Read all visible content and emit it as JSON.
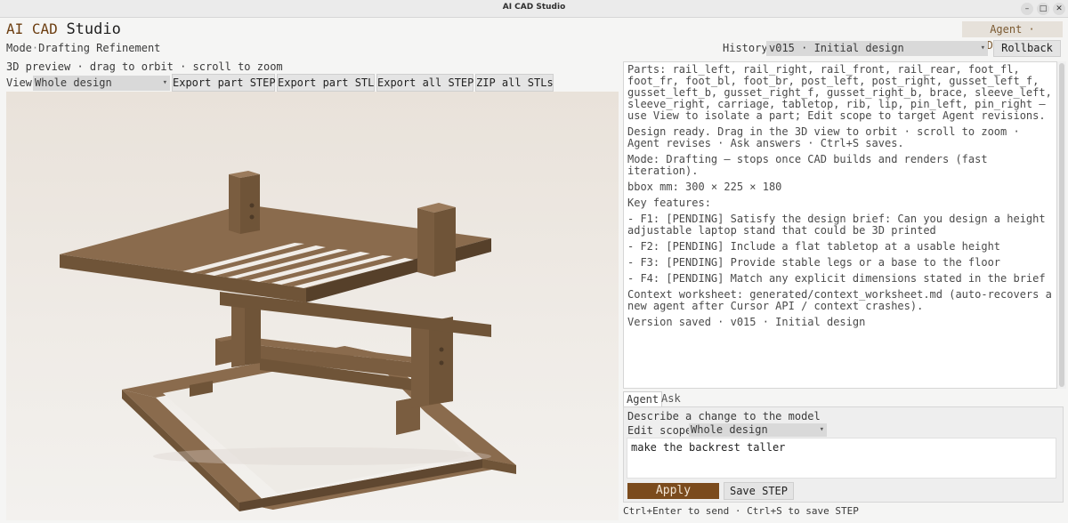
{
  "window": {
    "title": "AI CAD Studio",
    "controls": [
      "–",
      "□",
      "✕"
    ]
  },
  "brand": {
    "part_a": "AI CAD",
    "part_b": "Studio"
  },
  "mode_badge": "Agent · Drafting",
  "mode_row": {
    "label": "Mode",
    "value": "Drafting Refinement"
  },
  "history": {
    "label": "History",
    "selected": "v015 · Initial design",
    "rollback_label": "Rollback"
  },
  "preview_hint": "3D preview · drag to orbit · scroll to zoom",
  "toolbar": {
    "view_label": "View",
    "view_selected": "Whole design",
    "export_part_step": "Export part STEP",
    "export_part_stl": "Export part STL",
    "export_all_step": "Export all STEP",
    "zip_all_stls": "ZIP all STLs"
  },
  "info_lines": [
    "Parts: rail_left, rail_right, rail_front, rail_rear, foot_fl, foot_fr, foot_bl, foot_br, post_left, post_right, gusset_left_f, gusset_left_b, gusset_right_f, gusset_right_b, brace, sleeve_left, sleeve_right, carriage, tabletop, rib, lip, pin_left, pin_right — use View to isolate a part; Edit scope to target Agent revisions.",
    "Design ready. Drag in the 3D view to orbit · scroll to zoom · Agent revises · Ask answers · Ctrl+S saves.",
    "Mode: Drafting — stops once CAD builds and renders (fast iteration).",
    "bbox mm: 300 × 225 × 180",
    "Key features:",
    "- F1: [PENDING] Satisfy the design brief: Can you design a height adjustable laptop stand that could be 3D printed",
    "- F2: [PENDING] Include a flat tabletop at a usable height",
    "- F3: [PENDING] Provide stable legs or a base to the floor",
    "- F4: [PENDING] Match any explicit dimensions stated in the brief",
    "Context worksheet: generated/context_worksheet.md (auto-recovers a new agent after Cursor API / context crashes).",
    "Version saved · v015 · Initial design"
  ],
  "tabs": {
    "agent": "Agent",
    "ask": "Ask"
  },
  "agent_panel": {
    "describe_label": "Describe a change to the model",
    "scope_label": "Edit scope",
    "scope_selected": "Whole design",
    "prompt_value": "make the backrest taller",
    "apply_label": "Apply",
    "save_step_label": "Save STEP"
  },
  "footer_hint": "Ctrl+Enter to send · Ctrl+S to save STEP",
  "colors": {
    "accent": "#7b4b1d",
    "wood_top": "#8a6b4d",
    "wood_side": "#6f5438",
    "wood_dark": "#56402a"
  },
  "icons": {
    "dropdown": "chevron-down-icon"
  }
}
